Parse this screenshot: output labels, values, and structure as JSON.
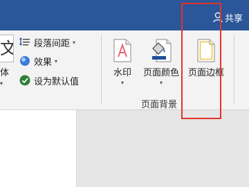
{
  "titlebar": {
    "share_label": "共享",
    "share_icon": "person-icon",
    "background": "#2b579a"
  },
  "ribbon": {
    "font_group": {
      "sample_glyph": "文",
      "label": "体",
      "arrow": "▾"
    },
    "paragraph_spacing": {
      "label": "段落间距",
      "icon": "paragraph-spacing-icon",
      "arrow": "▾"
    },
    "effects": {
      "label": "效果",
      "icon": "effects-icon",
      "arrow": "▾"
    },
    "set_default": {
      "label": "设为默认值",
      "icon": "checkmark-circle-icon"
    },
    "watermark": {
      "label": "水印",
      "icon": "watermark-icon",
      "arrow": "▾"
    },
    "page_color": {
      "label": "页面颜色",
      "icon": "paint-bucket-icon",
      "arrow": "▾"
    },
    "page_borders": {
      "label": "页面边框",
      "icon": "page-border-icon"
    },
    "group_label": "页面背景"
  },
  "highlight_color": "#e2322b"
}
